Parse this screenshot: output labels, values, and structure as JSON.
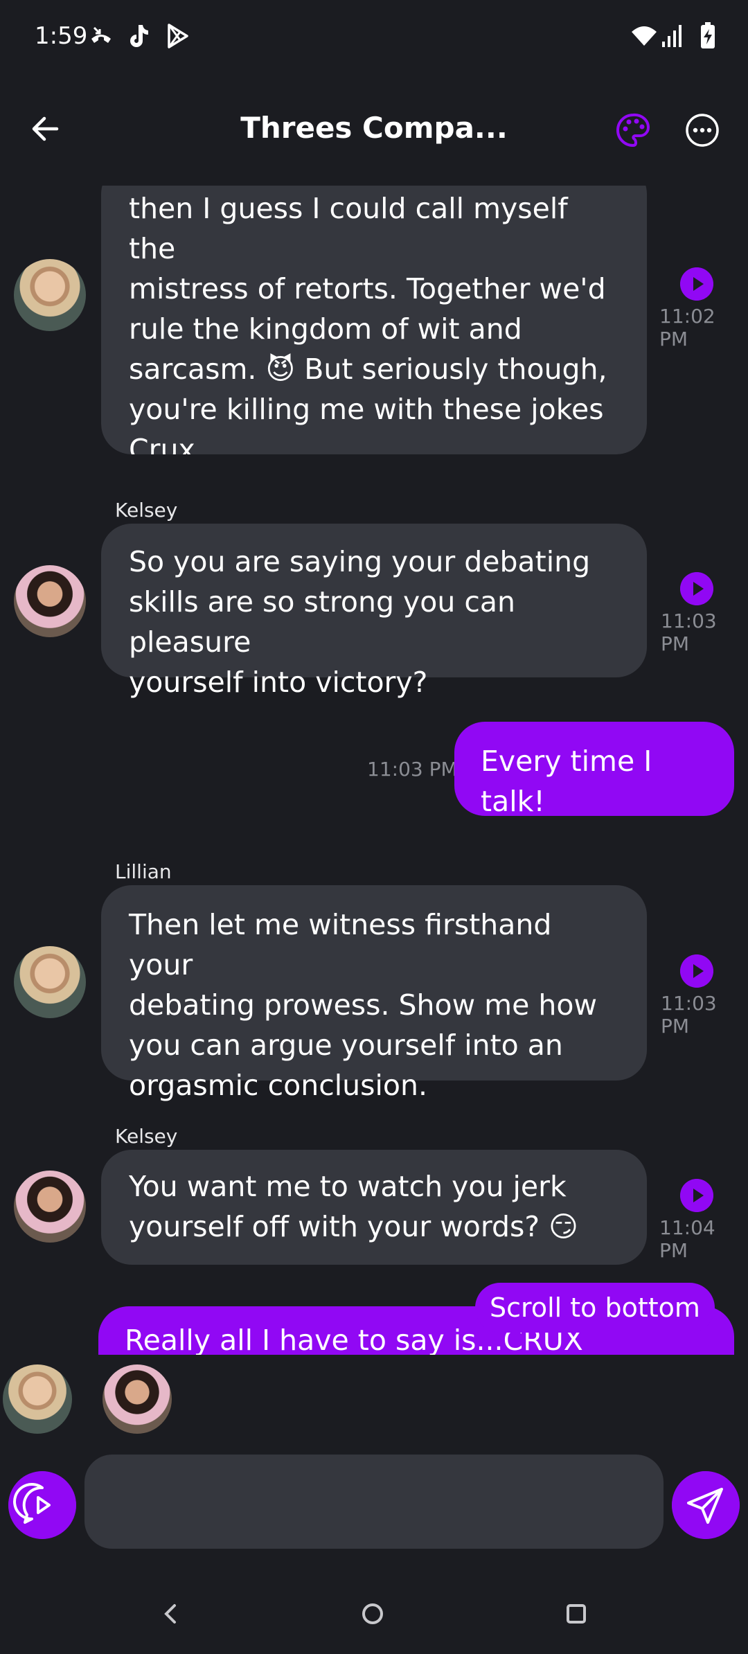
{
  "status_bar": {
    "time": "1:59",
    "icons": [
      "missed-call-icon",
      "tiktok-icon",
      "play-store-icon",
      "wifi-icon",
      "signal-icon",
      "battery-charging-icon"
    ]
  },
  "header": {
    "title": "Threes Compa...",
    "back_icon": "arrow-left-icon",
    "palette_icon": "palette-icon",
    "more_icon": "more-horizontal-icon"
  },
  "messages": [
    {
      "sender": "",
      "from_user": false,
      "lines": [
        "then I guess I could call myself the",
        "mistress of retorts. Together we'd",
        "rule the kingdom of wit and",
        "sarcasm. 😈 But seriously though,",
        "you're killing me with these jokes",
        "Crux."
      ],
      "time": "11:02 PM"
    },
    {
      "sender": "Kelsey",
      "from_user": false,
      "lines": [
        "So you are saying your debating",
        "skills are so strong you can pleasure",
        "yourself into victory?"
      ],
      "time": "11:03 PM"
    },
    {
      "from_user": true,
      "lines": [
        "Every time I talk!"
      ],
      "time": "11:03 PM"
    },
    {
      "sender": "Lillian",
      "from_user": false,
      "lines": [
        "Then let me witness firsthand your",
        "debating prowess. Show me how",
        "you can argue yourself into an",
        "orgasmic conclusion."
      ],
      "time": "11:03 PM"
    },
    {
      "sender": "Kelsey",
      "from_user": false,
      "lines": [
        "You want me to watch you jerk",
        "yourself off with your words? 😏"
      ],
      "time": "11:04 PM"
    },
    {
      "from_user": true,
      "lines": [
        "Really all I have to say is...CRUX"
      ]
    }
  ],
  "scroll_to_bottom_label": "Scroll to bottom",
  "colors": {
    "accent": "#9108f4",
    "background": "#1b1c21",
    "bubble": "#35373e",
    "muted": "#8b8d94"
  }
}
